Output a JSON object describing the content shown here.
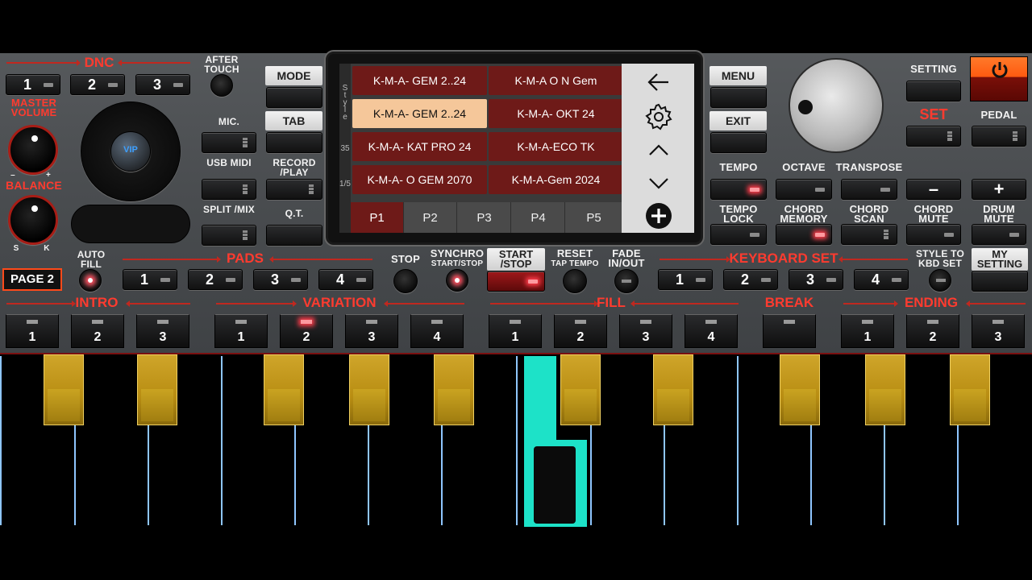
{
  "colors": {
    "accent_red": "#ff3b2f",
    "slot_bg": "#6e1a18",
    "slot_selected": "#f5c79a",
    "key_gold": "#cfa52a",
    "pressed_key": "#1de2c8",
    "power": "#ff6a1a"
  },
  "dnc": {
    "title": "DNC",
    "buttons": [
      "1",
      "2",
      "3"
    ]
  },
  "left": {
    "master_volume": "MASTER VOLUME",
    "balance": "BALANCE",
    "balance_s": "S",
    "balance_k": "K",
    "minus": "–",
    "plus": "+",
    "after_touch": "AFTER TOUCH",
    "page": "PAGE 2",
    "auto_fill": "AUTO FILL",
    "joystick_logo": "VIP"
  },
  "mid_left": {
    "mic": "MIC.",
    "usb_midi": "USB MIDI",
    "record_play": "RECORD /PLAY",
    "split_mix": "SPLIT /MIX",
    "qt": "Q.T.",
    "mode": "MODE",
    "tab": "TAB"
  },
  "screen": {
    "side_text": [
      "S",
      "t",
      "y",
      "l",
      "e",
      "35",
      "1/5"
    ],
    "slots": [
      "K-M-A- GEM 2..24",
      "K-M-A O N Gem",
      "K-M-A- GEM 2..24",
      "K-M-A- OKT 24",
      "K-M-A- KAT PRO  24",
      "K-M-A-ECO TK",
      "K-M-A- O GEM 2070",
      "K-M-A-Gem  2024"
    ],
    "selected_slot": 2,
    "tabs": [
      "P1",
      "P2",
      "P3",
      "P4",
      "P5"
    ],
    "selected_tab": 0,
    "nav_icons": [
      "arrow-left-icon",
      "gear-icon",
      "chevron-up-icon",
      "chevron-down-icon",
      "plus-circle-icon"
    ]
  },
  "right": {
    "menu": "MENU",
    "exit": "EXIT",
    "setting": "SETTING",
    "set": "SET",
    "pedal": "PEDAL",
    "tempo": "TEMPO",
    "octave": "OCTAVE",
    "transpose": "TRANSPOSE",
    "minus": "–",
    "plus": "+",
    "tempo_lock": "TEMPO LOCK",
    "chord_memory": "CHORD MEMORY",
    "chord_scan": "CHORD SCAN",
    "chord_mute": "CHORD MUTE",
    "drum_mute": "DRUM MUTE",
    "style_to_kbd": "STYLE TO KBD SET",
    "my_setting": "MY SETTING"
  },
  "pads": {
    "title": "PADS",
    "buttons": [
      "1",
      "2",
      "3",
      "4"
    ]
  },
  "transport": {
    "stop": "STOP",
    "synchro": "SYNCHRO",
    "synchro_sub": "START/STOP",
    "start_stop": "START /STOP",
    "reset": "RESET",
    "reset_sub": "TAP TEMPO",
    "fade": "FADE IN/OUT"
  },
  "keyboard_set": {
    "title": "KEYBOARD SET",
    "buttons": [
      "1",
      "2",
      "3",
      "4"
    ]
  },
  "sections": {
    "intro": {
      "title": "INTRO",
      "buttons": [
        "1",
        "2",
        "3"
      ]
    },
    "variation": {
      "title": "VARIATION",
      "buttons": [
        "1",
        "2",
        "3",
        "4"
      ],
      "active": 1
    },
    "fill": {
      "title": "FILL",
      "buttons": [
        "1",
        "2",
        "3",
        "4"
      ]
    },
    "break": {
      "title": "BREAK"
    },
    "ending": {
      "title": "ENDING",
      "buttons": [
        "1",
        "2",
        "3"
      ]
    }
  }
}
